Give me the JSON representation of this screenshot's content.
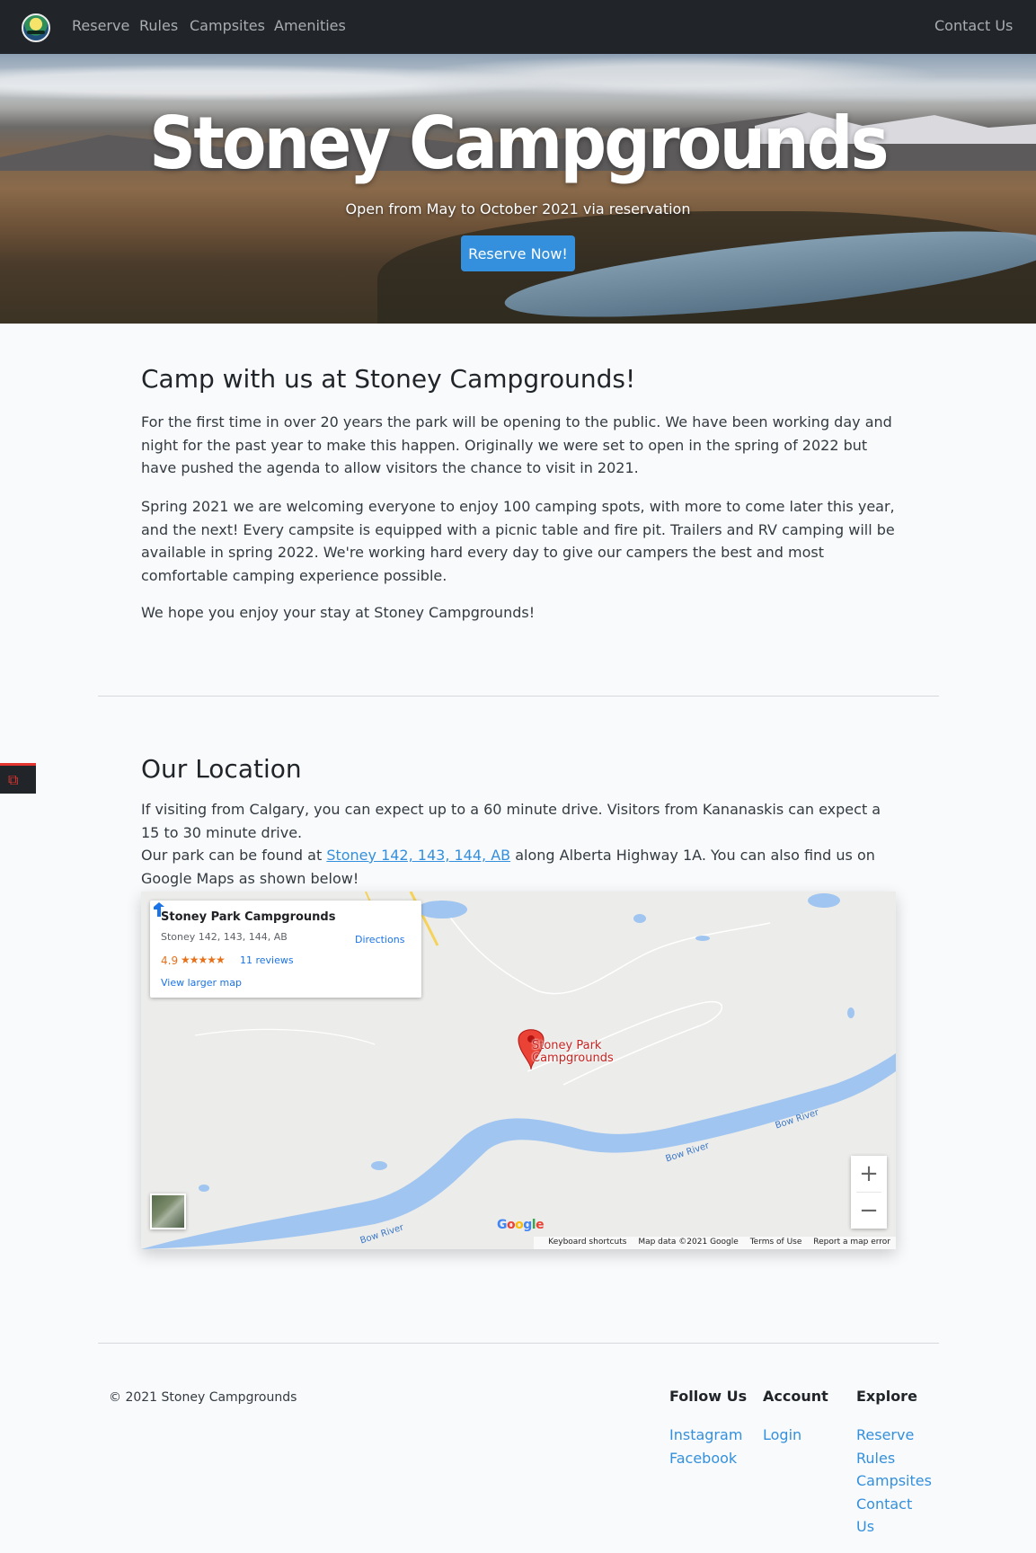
{
  "nav": {
    "links": [
      "Reserve",
      "Rules",
      "Campsites",
      "Amenities"
    ],
    "contact": "Contact Us"
  },
  "hero": {
    "title": "Stoney Campgrounds",
    "subtitle": "Open from May to October 2021 via reservation",
    "button": "Reserve Now!"
  },
  "intro": {
    "heading": "Camp with us at Stoney Campgrounds!",
    "p1": "For the first time in over 20 years the park will be opening to the public. We have been working day and night for the past year to make this happen. Originally we were set to open in the spring of 2022 but have pushed the agenda to allow visitors the chance to visit in 2021.",
    "p2": "Spring 2021 we are welcoming everyone to enjoy 100 camping spots, with more to come later this year, and the next! Every campsite is equipped with a picnic table and fire pit. Trailers and RV camping will be available in spring 2022. We're working hard every day to give our campers the best and most comfortable camping experience possible.",
    "p3": "We hope you enjoy your stay at Stoney Campgrounds!"
  },
  "location": {
    "heading": "Our Location",
    "p1": "If visiting from Calgary, you can expect up to a 60 minute drive. Visitors from Kananaskis can expect a 15 to 30 minute drive.",
    "p2_before": "Our park can be found at ",
    "p2_link": "Stoney 142, 143, 144, AB",
    "p2_after": " along Alberta Highway 1A. You can also find us on Google Maps as shown below!"
  },
  "map": {
    "place_name": "Stoney Park Campgrounds",
    "address": "Stoney 142, 143, 144, AB",
    "rating": "4.9",
    "stars": "★★★★★",
    "reviews": "11 reviews",
    "larger_map": "View larger map",
    "directions": "Directions",
    "pin_label_line1": "Stoney Park",
    "pin_label_line2": "Campgrounds",
    "river_label": "Bow River",
    "zoom_in": "+",
    "zoom_out": "−",
    "google": "Google",
    "footer_links": [
      "Keyboard shortcuts",
      "Map data ©2021 Google",
      "Terms of Use",
      "Report a map error"
    ]
  },
  "footer": {
    "copyright": "© 2021 Stoney Campgrounds",
    "follow_heading": "Follow Us",
    "follow_links": [
      "Instagram",
      "Facebook"
    ],
    "account_heading": "Account",
    "account_links": [
      "Login"
    ],
    "explore_heading": "Explore",
    "explore_links": [
      "Reserve",
      "Rules",
      "Campsites",
      "Contact",
      "Us"
    ]
  },
  "colors": {
    "navbar": "#212529",
    "accent": "#3490dc",
    "pin": "#ea4335",
    "river": "#a0c5f0"
  }
}
